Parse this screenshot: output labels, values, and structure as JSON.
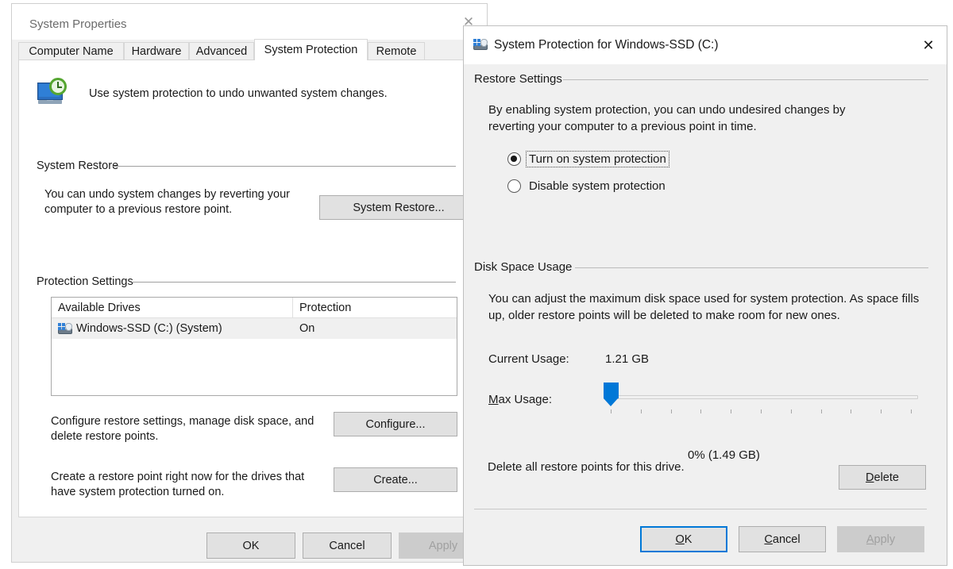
{
  "background_window": {
    "title": "System Properties",
    "close_icon": "✕",
    "tabs": [
      {
        "label": "Computer Name",
        "active": false
      },
      {
        "label": "Hardware",
        "active": false
      },
      {
        "label": "Advanced",
        "active": false
      },
      {
        "label": "System Protection",
        "active": true
      },
      {
        "label": "Remote",
        "active": false
      }
    ],
    "header_text": "Use system protection to undo unwanted system changes.",
    "system_restore": {
      "group_title": "System Restore",
      "description": "You can undo system changes by reverting your computer to a previous restore point.",
      "button_label": "System Restore..."
    },
    "protection_settings": {
      "group_title": "Protection Settings",
      "columns": [
        "Available Drives",
        "Protection"
      ],
      "rows": [
        {
          "drive": "Windows-SSD (C:) (System)",
          "protection": "On",
          "selected": true
        }
      ],
      "configure_description": "Configure restore settings, manage disk space, and delete restore points.",
      "configure_button": "Configure...",
      "create_description": "Create a restore point right now for the drives that have system protection turned on.",
      "create_button": "Create..."
    },
    "footer_buttons": [
      {
        "label": "OK",
        "disabled": false
      },
      {
        "label": "Cancel",
        "disabled": false
      },
      {
        "label": "Apply",
        "disabled": true
      }
    ]
  },
  "dialog": {
    "title": "System Protection for Windows-SSD (C:)",
    "close_icon": "✕",
    "restore_settings": {
      "group_title": "Restore Settings",
      "description": "By enabling system protection, you can undo undesired changes by reverting your computer to a previous point in time.",
      "options": [
        {
          "label": "Turn on system protection",
          "selected": true,
          "focused": true
        },
        {
          "label": "Disable system protection",
          "selected": false,
          "focused": false
        }
      ]
    },
    "disk_space_usage": {
      "group_title": "Disk Space Usage",
      "description": "You can adjust the maximum disk space used for system protection. As space fills up, older restore points will be deleted to make room for new ones.",
      "current_usage_label": "Current Usage:",
      "current_usage_value": "1.21 GB",
      "max_usage_label": "Max Usage:",
      "max_usage_accel": "M",
      "max_usage_label_rest": "ax Usage:",
      "slider_percent": 0,
      "slider_value_text": "0% (1.49 GB)",
      "slider_tick_count": 11,
      "delete_description": "Delete all restore points for this drive.",
      "delete_button": "Delete",
      "delete_button_accel": "D",
      "delete_button_rest": "elete"
    },
    "footer_buttons": [
      {
        "label": "OK",
        "accel": "O",
        "rest": "K",
        "disabled": false,
        "focused": true
      },
      {
        "label": "Cancel",
        "accel": "C",
        "rest": "ancel",
        "disabled": false,
        "focused": false
      },
      {
        "label": "Apply",
        "accel": "A",
        "rest": "pply",
        "disabled": true,
        "focused": false
      }
    ]
  },
  "colors": {
    "accent": "#0078d7",
    "dialog_bg": "#f0f0f0",
    "button_bg": "#e1e1e1",
    "disabled_text": "#a0a0a0"
  }
}
